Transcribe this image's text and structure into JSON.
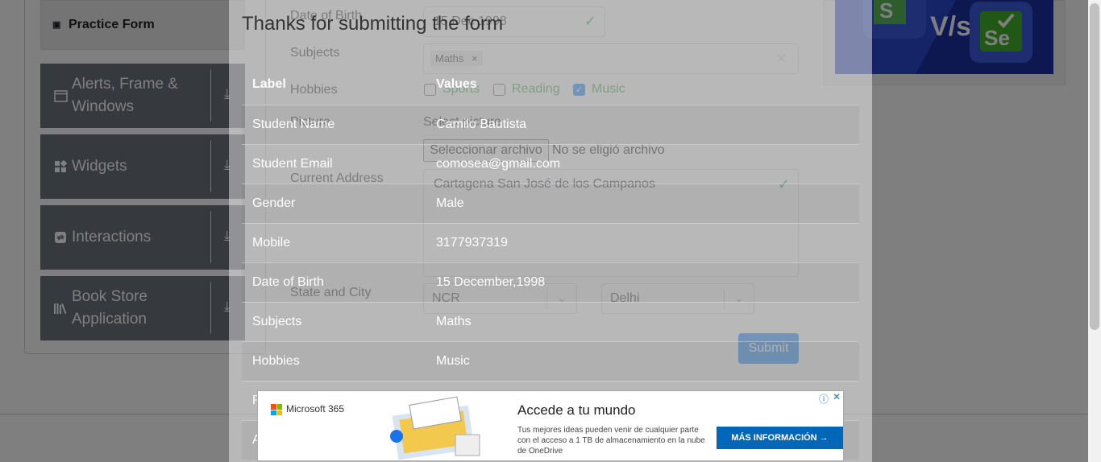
{
  "sidebar": {
    "practice_form": "Practice Form",
    "groups": [
      {
        "label": "Alerts, Frame & Windows"
      },
      {
        "label": "Widgets"
      },
      {
        "label": "Interactions"
      },
      {
        "label": "Book Store Application"
      }
    ]
  },
  "form": {
    "dob_label": "Date of Birth",
    "dob_value": "15 Dec 1998",
    "subjects_label": "Subjects",
    "subject_chip": "Maths",
    "hobbies_label": "Hobbies",
    "hobbies": [
      "Sports",
      "Reading",
      "Music"
    ],
    "picture_label": "Picture",
    "select_picture": "Select picture",
    "file_button": "Seleccionar archivo",
    "file_status": "No se eligió archivo",
    "address_label": "Current Address",
    "address_value": "Cartagena San José de los Campanos",
    "state_city_label": "State and City",
    "state_value": "NCR",
    "city_value": "Delhi",
    "submit": "Submit"
  },
  "modal": {
    "title": "Thanks for submitting the form",
    "header": {
      "label": "Label",
      "values": "Values"
    },
    "rows": [
      {
        "label": "Student Name",
        "value": "Camilo Bautista"
      },
      {
        "label": "Student Email",
        "value": "comosea@gmail.com"
      },
      {
        "label": "Gender",
        "value": "Male"
      },
      {
        "label": "Mobile",
        "value": "3177937319"
      },
      {
        "label": "Date of Birth",
        "value": "15 December,1998"
      },
      {
        "label": "Subjects",
        "value": "Maths"
      },
      {
        "label": "Hobbies",
        "value": "Music"
      },
      {
        "label": "P",
        "value": ""
      },
      {
        "label": "A",
        "value": ""
      }
    ]
  },
  "ad": {
    "brand": "Microsoft 365",
    "headline": "Accede a tu mundo",
    "body": "Tus mejores ideas pueden venir de cualquier parte con el acceso a 1 TB de almacenamiento en la nube de OneDrive",
    "cta": "MÁS INFORMACIÓN →",
    "info_icon": "ⓘ",
    "close_icon": "✕"
  },
  "colors": {
    "accent": "#007bff",
    "success": "#28a745",
    "sidebar": "#6c757d"
  }
}
